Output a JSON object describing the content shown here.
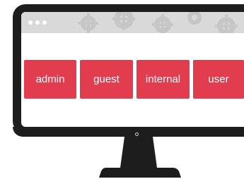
{
  "roles": {
    "items": [
      {
        "label": "admin"
      },
      {
        "label": "guest"
      },
      {
        "label": "internal"
      },
      {
        "label": "user"
      }
    ]
  },
  "colors": {
    "button": "#e23d4f",
    "bezel": "#1d1d1d",
    "browser_bar": "#d9d9d9"
  }
}
